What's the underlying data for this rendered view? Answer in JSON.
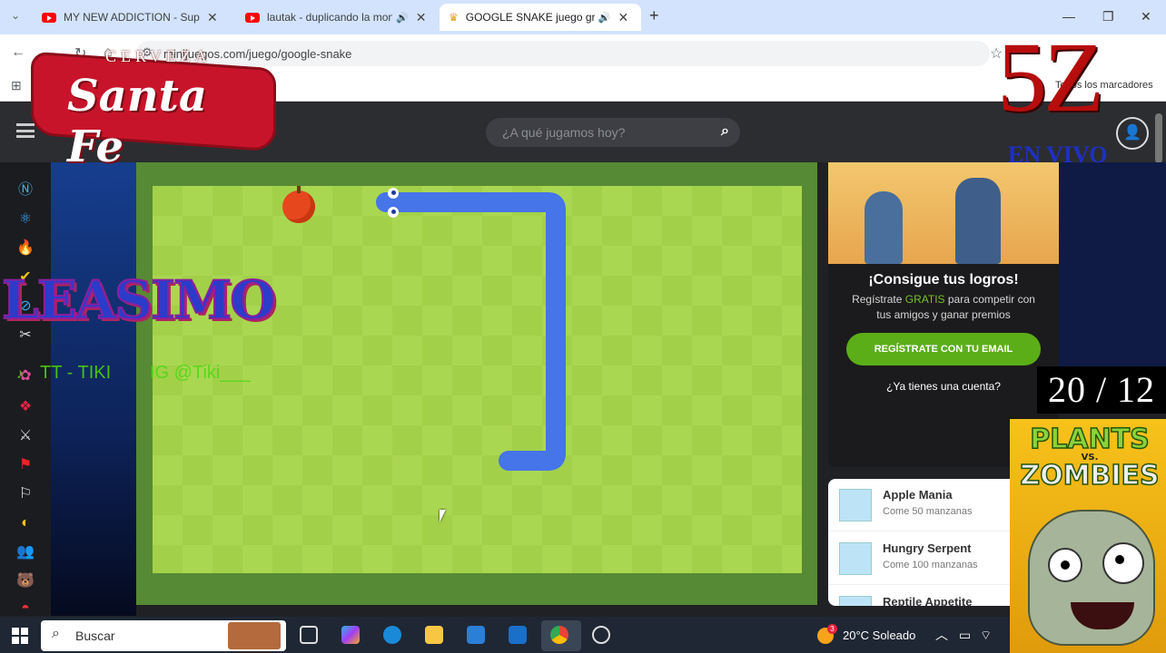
{
  "browser": {
    "tabs": [
      {
        "title": "MY NEW ADDICTION - Superm",
        "icon": "youtube-icon"
      },
      {
        "title": "lautak - duplicando la mon",
        "icon": "youtube-icon"
      },
      {
        "title": "GOOGLE SNAKE juego grati",
        "icon": "crown-icon",
        "active": true
      }
    ],
    "url": "minijuegos.com/juego/google-snake",
    "bookmarks_label": "Todos los marcadores"
  },
  "site": {
    "search_placeholder": "¿A qué jugamos hoy?"
  },
  "promo": {
    "title": "¡Consigue tus logros!",
    "sub_pre": "Regístrate ",
    "sub_gratis": "GRATIS",
    "sub_post": " para competir con tus amigos y ganar premios",
    "register_button": "REGÍSTRATE CON TU EMAIL",
    "login_link": "¿Ya tienes una cuenta?"
  },
  "achievements": [
    {
      "title": "Apple Mania",
      "desc": "Come 50 manzanas"
    },
    {
      "title": "Hungry Serpent",
      "desc": "Come 100 manzanas"
    },
    {
      "title": "Reptile Appetite",
      "desc": ""
    }
  ],
  "taskbar": {
    "search_label": "Buscar",
    "weather": "20°C  Soleado",
    "weather_badge": "3"
  },
  "overlay": {
    "brand_small": "CERVEZA",
    "brand_name": "Santa Fe",
    "channel": "5Z",
    "live": "EN VIVO",
    "streamer": "LEASIMO",
    "tiktok": "TT - TIKI",
    "instagram": "IG @Tiki___",
    "counter": "20 / 12",
    "game_art_line1": "PLANTS",
    "game_art_vs": "VS.",
    "game_art_line2": "ZOMBIES"
  },
  "colors": {
    "snake": "#4674e9",
    "board_light": "#aad751",
    "board_dark": "#a2d149",
    "frame": "#578a34",
    "apple": "#e7471d",
    "register_button": "#5bae18"
  }
}
